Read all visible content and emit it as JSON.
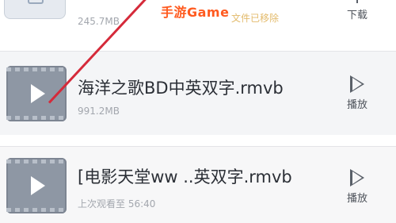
{
  "watermark": "手游Game",
  "items": [
    {
      "title": "",
      "size": "245.7MB",
      "status": "文件已移除",
      "action_label": "下载",
      "action_icon": "download-icon"
    },
    {
      "title": "海洋之歌BD中英双字.rmvb",
      "size": "991.2MB",
      "action_label": "播放",
      "action_icon": "play-outline-icon"
    },
    {
      "title": "[电影天堂ww ..英双字.rmvb",
      "progress_text": "上次观看至 56:40",
      "action_label": "播放",
      "action_icon": "play-outline-icon"
    }
  ],
  "colors": {
    "watermark": "#ff5a1f",
    "overlay_line": "#d52a3a",
    "status": "#e3bb6c"
  }
}
